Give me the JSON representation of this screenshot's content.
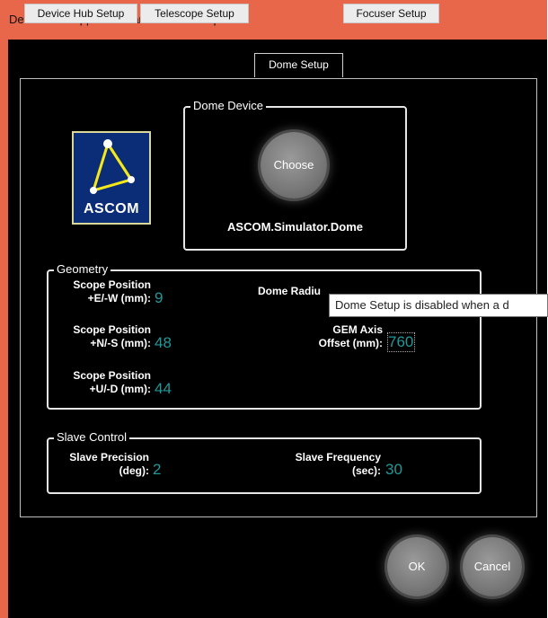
{
  "window": {
    "title": "Device Hub Application and Driver Setup"
  },
  "tabs": [
    {
      "label": "Device Hub Setup"
    },
    {
      "label": "Telescope Setup"
    },
    {
      "label": "Dome Setup"
    },
    {
      "label": "Focuser Setup"
    }
  ],
  "active_tab": "Dome Setup",
  "logo": {
    "text": "ASCOM"
  },
  "dome_device": {
    "legend": "Dome Device",
    "choose_label": "Choose",
    "device_name": "ASCOM.Simulator.Dome"
  },
  "geometry": {
    "legend": "Geometry",
    "scope_ew": {
      "label1": "Scope Position",
      "label2": "+E/-W (mm):",
      "value": "9"
    },
    "scope_ns": {
      "label1": "Scope Position",
      "label2": "+N/-S (mm):",
      "value": "48"
    },
    "scope_ud": {
      "label1": "Scope Position",
      "label2": "+U/-D (mm):",
      "value": "44"
    },
    "dome_radius": {
      "label": "Dome Radiu"
    },
    "gem_axis": {
      "label1": "GEM Axis",
      "label2": "Offset (mm):",
      "value": "760"
    }
  },
  "slave_control": {
    "legend": "Slave Control",
    "precision": {
      "label1": "Slave Precision",
      "label2": "(deg):",
      "value": "2"
    },
    "frequency": {
      "label1": "Slave Frequency",
      "label2": "(sec):",
      "value": "30"
    }
  },
  "tooltip": {
    "text": "Dome Setup is disabled when a d"
  },
  "buttons": {
    "ok": "OK",
    "cancel": "Cancel"
  },
  "colors": {
    "titlebar": "#e8674a",
    "value_text": "#1e9a9a",
    "background": "#000000"
  }
}
